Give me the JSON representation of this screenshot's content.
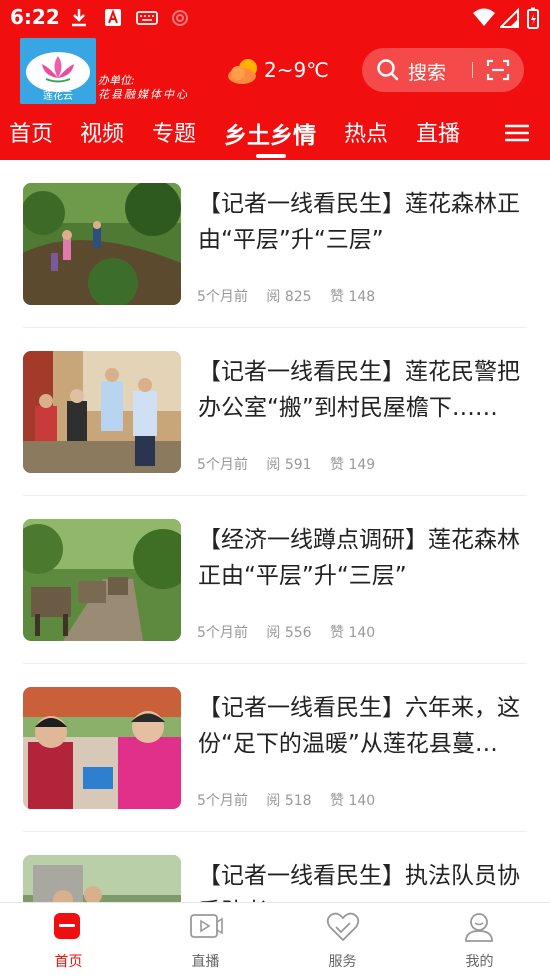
{
  "status_bar": {
    "time": "6:22"
  },
  "header": {
    "logo_text": "莲花云",
    "org_line1": "办单位:",
    "org_line2": "花县融媒体中心",
    "weather_temp": "2~9℃",
    "search_label": "搜索"
  },
  "nav": {
    "tabs": [
      "首页",
      "视频",
      "专题",
      "乡土乡情",
      "热点",
      "直播",
      "阝"
    ],
    "active_index": 3
  },
  "articles": [
    {
      "title": "【记者一线看民生】莲花森林正由“平层”升“三层”",
      "time": "5个月前",
      "reads": "阅 825",
      "likes": "赞 148"
    },
    {
      "title": "【记者一线看民生】莲花民警把办公室“搬”到村民屋檐下……",
      "time": "5个月前",
      "reads": "阅 591",
      "likes": "赞 149"
    },
    {
      "title": "【经济一线蹲点调研】莲花森林正由“平层”升“三层”",
      "time": "5个月前",
      "reads": "阅 556",
      "likes": "赞 140"
    },
    {
      "title": "【记者一线看民生】六年来，这份“足下的温暖”从莲花县蔓延……",
      "time": "5个月前",
      "reads": "阅 518",
      "likes": "赞 140"
    },
    {
      "title": "【记者一线看民生】执法队员协手队者",
      "time": "",
      "reads": "",
      "likes": ""
    }
  ],
  "bottom_nav": {
    "items": [
      "首页",
      "直播",
      "服务",
      "我的"
    ],
    "active_index": 0
  },
  "colors": {
    "brand": "#f10e0e",
    "meta": "#999999",
    "title": "#222222"
  }
}
